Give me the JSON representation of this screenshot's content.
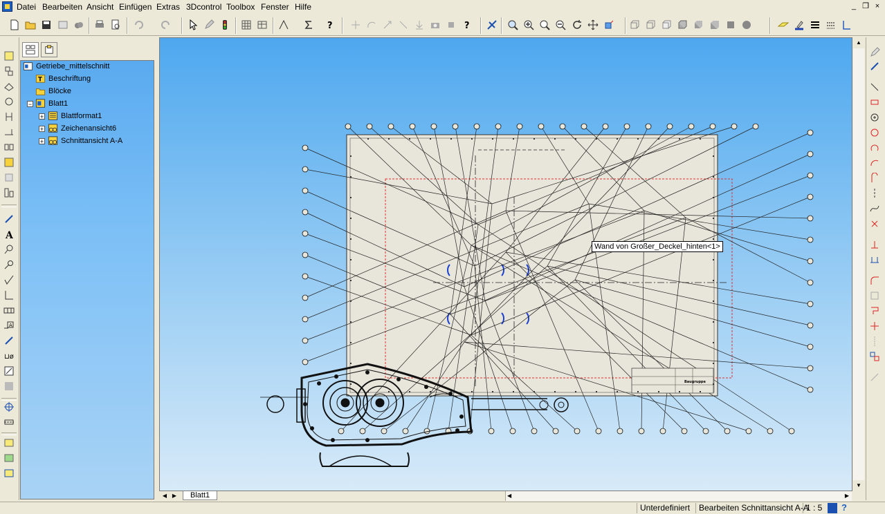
{
  "menubar": {
    "items": [
      "Datei",
      "Bearbeiten",
      "Ansicht",
      "Einfügen",
      "Extras",
      "3Dcontrol",
      "Toolbox",
      "Fenster",
      "Hilfe"
    ]
  },
  "window_controls": {
    "minimize": "_",
    "restore": "❐",
    "close": "×"
  },
  "tree": {
    "root": "Getriebe_mittelschnitt",
    "items": [
      {
        "label": "Beschriftung",
        "icon": "annotation-folder-icon"
      },
      {
        "label": "Blöcke",
        "icon": "folder-icon"
      },
      {
        "label": "Blatt1",
        "icon": "sheet-icon"
      },
      {
        "label": "Blattformat1",
        "icon": "sheet-format-icon"
      },
      {
        "label": "Zeichenansicht6",
        "icon": "drawing-view-icon"
      },
      {
        "label": "Schnittansicht A-A",
        "icon": "section-view-icon"
      }
    ]
  },
  "canvas": {
    "tooltip": "Wand von Großer_Deckel_hinten<1>",
    "title_block_text": "Baugruppe"
  },
  "sheet_tab": {
    "label": "Blatt1"
  },
  "statusbar": {
    "state": "Unterdefiniert",
    "editing": "Bearbeiten Schnittansicht A-A",
    "scale": "1 : 5"
  },
  "colors": {
    "canvas_top": "#4ea8ef",
    "canvas_bottom": "#d7eaf8",
    "sheet": "#e8e6da",
    "tree_bg": "#7dc0f6",
    "selection_red": "#e03030"
  }
}
